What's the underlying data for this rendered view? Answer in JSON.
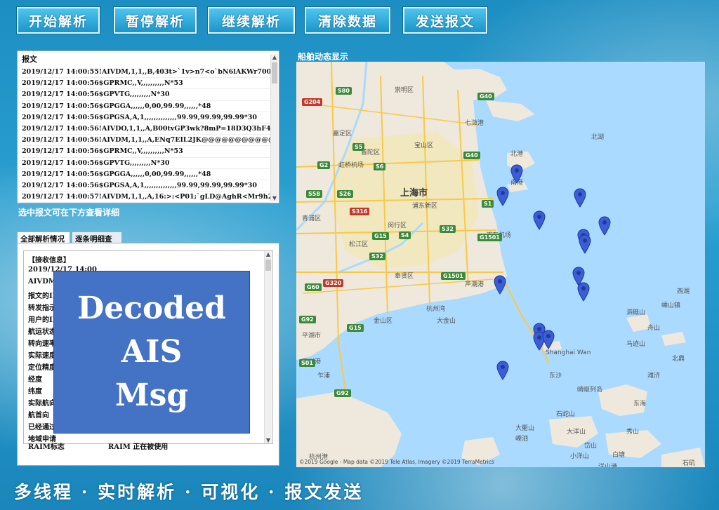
{
  "toolbar": {
    "start": "开始解析",
    "pause": "暂停解析",
    "resume": "继续解析",
    "clear": "清除数据",
    "send": "发送报文"
  },
  "message_panel": {
    "header": "报文",
    "rows": [
      "2019/12/17 14:00:55!AIVDM,1,1,,B,403t>`1v>n7<o`bN6lAKWr700<1...",
      "2019/12/17 14:00:56$GPRMC,,V,,,,,,,,,,N*53",
      "2019/12/17 14:00:56$GPVTG,,,,,,,,,N*30",
      "2019/12/17 14:00:56$GPGGA,,,,,,0,00,99.99,,,,,,*48",
      "2019/12/17 14:00:56$GPGSA,A,1,,,,,,,,,,,,,,99.99,99.99,99.99*30",
      "2019/12/17 14:00:56!AIVDO,1,1,,A,B00tvGP3wk?8mP=18D3Q3hF4SP...",
      "2019/12/17 14:00:56!AIVDM,1,1,,A,ENq7EIL2JK@@@@@@@@@@@...",
      "2019/12/17 14:00:56$GPRMC,,V,,,,,,,,,,N*53",
      "2019/12/17 14:00:56$GPVTG,,,,,,,,,N*30",
      "2019/12/17 14:00:56$GPGGA,,,,,,0,00,99.99,,,,,,*48",
      "2019/12/17 14:00:56$GPGSA,A,1,,,,,,,,,,,,,,99.99,99.99,99.99*30",
      "2019/12/17 14:00:57!AIVDM,1,1,,A,16:>:<P01;`gLD@AghR<Mr9h2D..."
    ],
    "hint": "选中报文可在下方查看详细"
  },
  "tabs": {
    "all": "全部解析情况",
    "detail": "逐条明细查看"
  },
  "detail_panel": {
    "rows": [
      "【接收信息】",
      "2019/12/17 14:00",
      "AIVDM",
      "报文的II",
      "转发指示",
      "用户的II",
      "航运状态",
      "转向速率",
      "实际速度",
      "定位精度",
      "经度",
      "纬度",
      "实际航向",
      "航首向",
      "已经通过",
      "地域申请"
    ],
    "raim_label": "RAIM标志",
    "raim_value": "RAIM 正在被使用"
  },
  "overlay": {
    "line1": "Decoded",
    "line2": "AIS",
    "line3": "Msg"
  },
  "map": {
    "title": "船舶动态显示",
    "city": "上海市",
    "labels": [
      "崇明区",
      "七滧港",
      "宝山区",
      "嘉定区",
      "普陀区",
      "浦东新区",
      "闵行区",
      "松江区",
      "青浦区",
      "奉贤区",
      "金山区",
      "平湖市",
      "杭州湾",
      "西湖",
      "北港",
      "南港",
      "北湖",
      "舟山",
      "杭州港",
      "乍浦",
      "Shanghai Wan",
      "大衢山",
      "嵊泗",
      "洋山港",
      "小洋山",
      "东海",
      "岱山",
      "虹桥机场",
      "浦东机场",
      "嘉兴港",
      "芦潮港",
      "大金山",
      "泗礁山",
      "嵊山镇",
      "马迹山",
      "石矶",
      "滩浒",
      "东沙",
      "北鼎",
      "崎岖列岛",
      "白塘",
      "大洋山",
      "秀山",
      "石蛇山"
    ],
    "shields": [
      "S80",
      "G40",
      "G204",
      "G2",
      "S5",
      "S6",
      "S58",
      "S26",
      "S316",
      "G40",
      "G1501",
      "S32",
      "G15",
      "S4",
      "G1501",
      "S32",
      "G60",
      "G320",
      "G15",
      "S1",
      "G92",
      "S01",
      "G92"
    ],
    "attribution": "©2019 Google - Map data ©2019 Tele Atlas, Imagery ©2019 TerraMetrics"
  },
  "footer": "多线程 · 实时解析 · 可视化 · 报文发送"
}
